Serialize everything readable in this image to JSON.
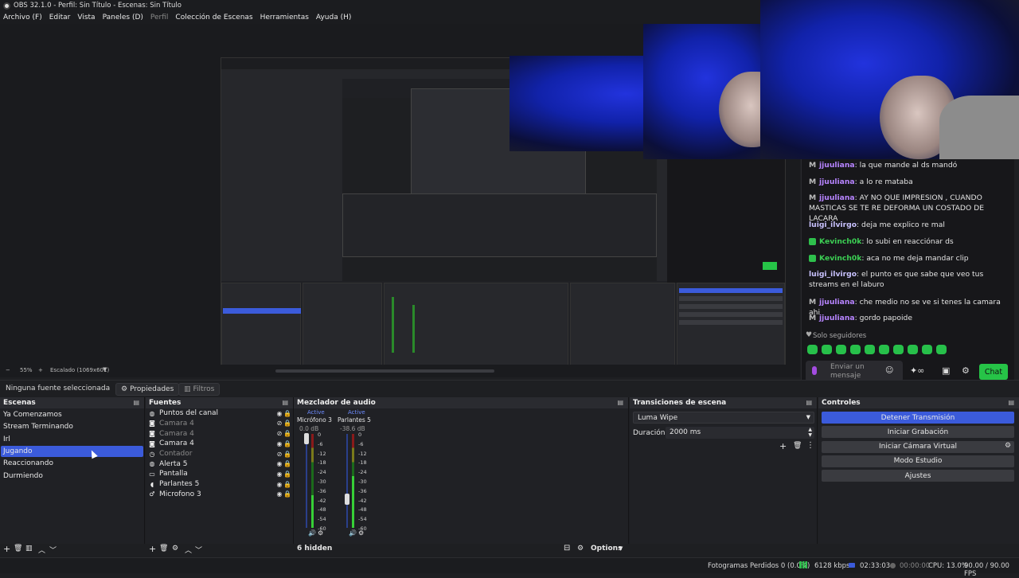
{
  "window": {
    "title": "OBS 32.1.0 - Perfil: Sin Título - Escenas: Sin Título"
  },
  "menu": [
    {
      "label": "Archivo (F)",
      "enabled": true
    },
    {
      "label": "Editar",
      "enabled": true
    },
    {
      "label": "Vista",
      "enabled": true
    },
    {
      "label": "Paneles (D)",
      "enabled": true
    },
    {
      "label": "Perfil",
      "enabled": false
    },
    {
      "label": "Colección de Escenas",
      "enabled": true
    },
    {
      "label": "Herramientas",
      "enabled": true
    },
    {
      "label": "Ayuda (H)",
      "enabled": true
    }
  ],
  "zoom": {
    "minus": "−",
    "value": "55%",
    "plus": "+",
    "scaled": "Escalado (1069x601)"
  },
  "chat": {
    "messages": [
      {
        "user": "jjuuliana",
        "color": "purple",
        "badge": "M",
        "text": ": la que mande al ds mandó"
      },
      {
        "user": "jjuuliana",
        "color": "purple",
        "badge": "M",
        "text": ": a lo re mataba"
      },
      {
        "user": "jjuuliana",
        "color": "purple",
        "badge": "M",
        "text": ": AY NO QUE IMPRESION , CUANDO MASTICAS SE TE RE DEFORMA UN COSTADO DE LACARA"
      },
      {
        "user": "luigi_ilvirgo",
        "color": "lav",
        "badge": "",
        "text": ": deja me explico re mal"
      },
      {
        "user": "Kevinch0k",
        "color": "green",
        "badge": "g",
        "text": ": lo subi en reacciónar ds"
      },
      {
        "user": "Kevinch0k",
        "color": "green",
        "badge": "g",
        "text": ": aca no me deja mandar clip"
      },
      {
        "user": "luigi_ilvirgo",
        "color": "lav",
        "badge": "",
        "text": ": el punto es que sabe que veo tus streams en el laburo"
      },
      {
        "user": "jjuuliana",
        "color": "purple",
        "badge": "M",
        "text": ": che medio no se ve si tenes la camara ahi"
      },
      {
        "user": "jjuuliana",
        "color": "purple",
        "badge": "M",
        "text": ": gordo papoide"
      }
    ],
    "followers_only": "Solo seguidores",
    "input_placeholder": "Enviar un mensaje",
    "send_button": "Chat",
    "emote_count": 10
  },
  "properties_bar": {
    "no_source": "Ninguna fuente seleccionada",
    "properties": "Propiedades",
    "filters": "Filtros"
  },
  "scenes": {
    "title": "Escenas",
    "items": [
      "Ya Comenzamos",
      "Stream Terminando",
      "Irl",
      "Jugando",
      "Reaccionando",
      "Durmiendo"
    ],
    "selected": "Jugando"
  },
  "sources": {
    "title": "Fuentes",
    "items": [
      {
        "label": "Puntos del canal",
        "icon": "browser-icon",
        "visible": true
      },
      {
        "label": "Camara 4",
        "icon": "camera-icon",
        "visible": false
      },
      {
        "label": "Camara 4",
        "icon": "camera-icon",
        "visible": false
      },
      {
        "label": "Camara 4",
        "icon": "camera-icon",
        "visible": true
      },
      {
        "label": "Contador",
        "icon": "clock-icon",
        "visible": false
      },
      {
        "label": "Alerta 5",
        "icon": "browser-icon",
        "visible": true
      },
      {
        "label": "Pantalla",
        "icon": "monitor-icon",
        "visible": true
      },
      {
        "label": "Parlantes 5",
        "icon": "speaker-icon",
        "visible": true
      },
      {
        "label": "Microfono 3",
        "icon": "mic-icon",
        "visible": true
      }
    ]
  },
  "mixer": {
    "title": "Mezclador de audio",
    "channels": [
      {
        "badge": "Active",
        "name": "Micrófono 3",
        "db": "0.0 dB",
        "level": 0.35
      },
      {
        "badge": "Active",
        "name": "Parlantes 5",
        "db": "-38.6 dB",
        "level": 0.55
      }
    ],
    "scale": [
      "0",
      "-6",
      "-12",
      "-18",
      "-24",
      "-30",
      "-36",
      "-42",
      "-48",
      "-54",
      "-60"
    ],
    "hidden": "6 hidden",
    "options": "Options"
  },
  "transitions": {
    "title": "Transiciones de escena",
    "selected": "Luma Wipe",
    "duration_label": "Duración",
    "duration_value": "2000 ms"
  },
  "controls": {
    "title": "Controles",
    "buttons": [
      "Detener Transmisión",
      "Iniciar Grabación",
      "Iniciar Cámara Virtual",
      "Modo Estudio",
      "Ajustes"
    ]
  },
  "status": {
    "dropped": "Fotogramas Perdidos 0 (0.0%)",
    "bitrate": "6128 kbps",
    "stream_time": "02:33:03",
    "rec_time": "00:00:00",
    "cpu": "CPU: 13.0%",
    "fps": "90.00 / 90.00 FPS"
  },
  "colors": {
    "accent": "#3b5bdb",
    "chat_green": "#26c447",
    "panel": "#202125"
  }
}
